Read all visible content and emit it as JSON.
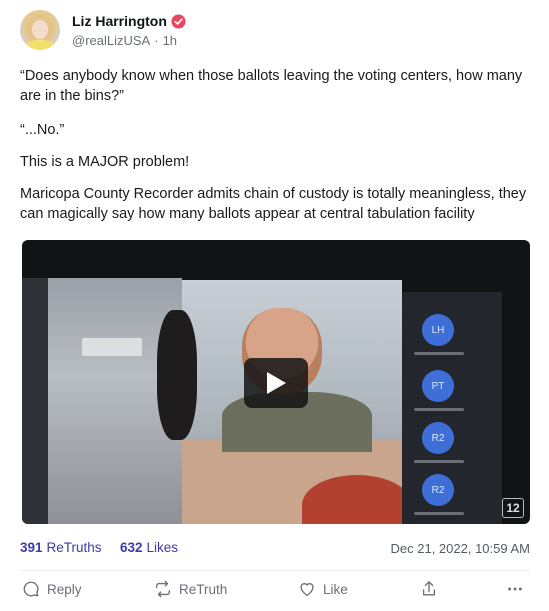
{
  "post": {
    "author_name": "Liz Harrington",
    "handle": "@realLizUSA",
    "separator": "·",
    "time_ago": "1h",
    "paragraphs": [
      "“Does anybody know when those ballots leaving the voting centers, how many are in the bins?”",
      "“...No.”",
      "This is a MAJOR problem!",
      "Maricopa County Recorder admits chain of custody is totally meaningless, they can magically say how many ballots appear at central tabulation facility"
    ]
  },
  "video": {
    "participants": [
      "LH",
      "PT",
      "R2",
      "R2"
    ],
    "channel_logo": "12",
    "play_icon": "play-icon"
  },
  "stats": {
    "retruths_count": "391",
    "retruths_label": "ReTruths",
    "likes_count": "632",
    "likes_label": "Likes",
    "date": "Dec 21, 2022, 10:59 AM"
  },
  "actions": {
    "reply_label": "Reply",
    "retruth_label": "ReTruth",
    "like_label": "Like"
  },
  "colors": {
    "verified_badge": "#e8455f",
    "stat_accent": "#3b3ba8",
    "participant_bubble": "#3d6fd6"
  }
}
